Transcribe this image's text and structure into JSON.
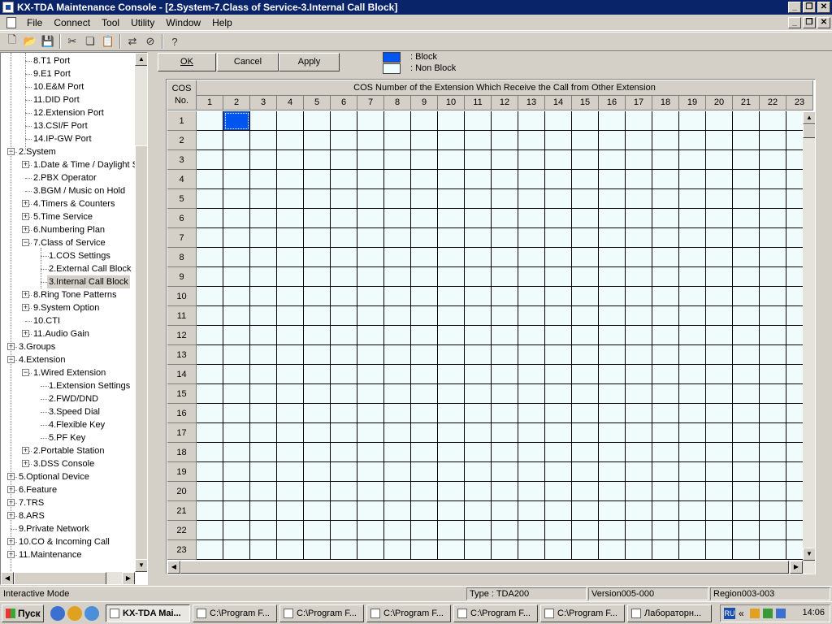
{
  "window": {
    "title": "KX-TDA Maintenance Console - [2.System-7.Class of Service-3.Internal Call Block]"
  },
  "menu": [
    "File",
    "Connect",
    "Tool",
    "Utility",
    "Window",
    "Help"
  ],
  "toolbar_icons": [
    "new-icon",
    "open-icon",
    "save-icon",
    "cut-icon",
    "copy-icon",
    "paste-icon",
    "connect-icon",
    "disconnect-icon",
    "help-icon"
  ],
  "tree": [
    {
      "label": "8.T1 Port",
      "level": 2,
      "expander": "none"
    },
    {
      "label": "9.E1 Port",
      "level": 2,
      "expander": "none"
    },
    {
      "label": "10.E&M Port",
      "level": 2,
      "expander": "none"
    },
    {
      "label": "11.DID Port",
      "level": 2,
      "expander": "none"
    },
    {
      "label": "12.Extension Port",
      "level": 2,
      "expander": "none"
    },
    {
      "label": "13.CSI/F Port",
      "level": 2,
      "expander": "none"
    },
    {
      "label": "14.IP-GW Port",
      "level": 2,
      "expander": "none"
    },
    {
      "label": "2.System",
      "level": 1,
      "expander": "minus"
    },
    {
      "label": "1.Date & Time / Daylight S",
      "level": 2,
      "expander": "plus"
    },
    {
      "label": "2.PBX Operator",
      "level": 2,
      "expander": "none"
    },
    {
      "label": "3.BGM / Music on Hold",
      "level": 2,
      "expander": "none"
    },
    {
      "label": "4.Timers & Counters",
      "level": 2,
      "expander": "plus"
    },
    {
      "label": "5.Time Service",
      "level": 2,
      "expander": "plus"
    },
    {
      "label": "6.Numbering Plan",
      "level": 2,
      "expander": "plus"
    },
    {
      "label": "7.Class of Service",
      "level": 2,
      "expander": "minus"
    },
    {
      "label": "1.COS Settings",
      "level": 3,
      "expander": "none"
    },
    {
      "label": "2.External Call Block",
      "level": 3,
      "expander": "none"
    },
    {
      "label": "3.Internal Call Block",
      "level": 3,
      "expander": "none",
      "selected": true
    },
    {
      "label": "8.Ring Tone Patterns",
      "level": 2,
      "expander": "plus"
    },
    {
      "label": "9.System Option",
      "level": 2,
      "expander": "plus"
    },
    {
      "label": "10.CTI",
      "level": 2,
      "expander": "none"
    },
    {
      "label": "11.Audio Gain",
      "level": 2,
      "expander": "plus"
    },
    {
      "label": "3.Groups",
      "level": 1,
      "expander": "plus"
    },
    {
      "label": "4.Extension",
      "level": 1,
      "expander": "minus"
    },
    {
      "label": "1.Wired Extension",
      "level": 2,
      "expander": "minus"
    },
    {
      "label": "1.Extension Settings",
      "level": 3,
      "expander": "none"
    },
    {
      "label": "2.FWD/DND",
      "level": 3,
      "expander": "none"
    },
    {
      "label": "3.Speed Dial",
      "level": 3,
      "expander": "none"
    },
    {
      "label": "4.Flexible Key",
      "level": 3,
      "expander": "none"
    },
    {
      "label": "5.PF Key",
      "level": 3,
      "expander": "none"
    },
    {
      "label": "2.Portable Station",
      "level": 2,
      "expander": "plus"
    },
    {
      "label": "3.DSS Console",
      "level": 2,
      "expander": "plus"
    },
    {
      "label": "5.Optional Device",
      "level": 1,
      "expander": "plus"
    },
    {
      "label": "6.Feature",
      "level": 1,
      "expander": "plus"
    },
    {
      "label": "7.TRS",
      "level": 1,
      "expander": "plus"
    },
    {
      "label": "8.ARS",
      "level": 1,
      "expander": "plus"
    },
    {
      "label": "9.Private Network",
      "level": 1,
      "expander": "none"
    },
    {
      "label": "10.CO & Incoming Call",
      "level": 1,
      "expander": "plus"
    },
    {
      "label": "11.Maintenance",
      "level": 1,
      "expander": "plus"
    }
  ],
  "buttons": {
    "ok": "OK",
    "cancel": "Cancel",
    "apply": "Apply"
  },
  "legend": {
    "block_label": ": Block",
    "nonblock_label": ": Non Block",
    "block_color": "#0055ee",
    "nonblock_color": "#f0fbfb"
  },
  "grid": {
    "corner_label": "COS\nNo.",
    "header_label": "COS Number of the Extension Which Receive the Call from Other Extension",
    "columns": [
      "1",
      "2",
      "3",
      "4",
      "5",
      "6",
      "7",
      "8",
      "9",
      "10",
      "11",
      "12",
      "13",
      "14",
      "15",
      "16",
      "17",
      "18",
      "19",
      "20",
      "21",
      "22",
      "23"
    ],
    "rows": [
      "1",
      "2",
      "3",
      "4",
      "5",
      "6",
      "7",
      "8",
      "9",
      "10",
      "11",
      "12",
      "13",
      "14",
      "15",
      "16",
      "17",
      "18",
      "19",
      "20",
      "21",
      "22",
      "23"
    ],
    "blocked_cells": [
      [
        1,
        2
      ]
    ]
  },
  "status": {
    "mode": "Interactive Mode",
    "type": "Type : TDA200",
    "version": "Version005-000",
    "region": "Region003-003"
  },
  "taskbar": {
    "start": "Пуск",
    "tasks": [
      "KX-TDA Mai...",
      "C:\\Program F...",
      "C:\\Program F...",
      "C:\\Program F...",
      "C:\\Program F...",
      "C:\\Program F...",
      "Лабораторн..."
    ],
    "lang": "RU",
    "tray_chevron": "«",
    "clock": "14:06"
  }
}
